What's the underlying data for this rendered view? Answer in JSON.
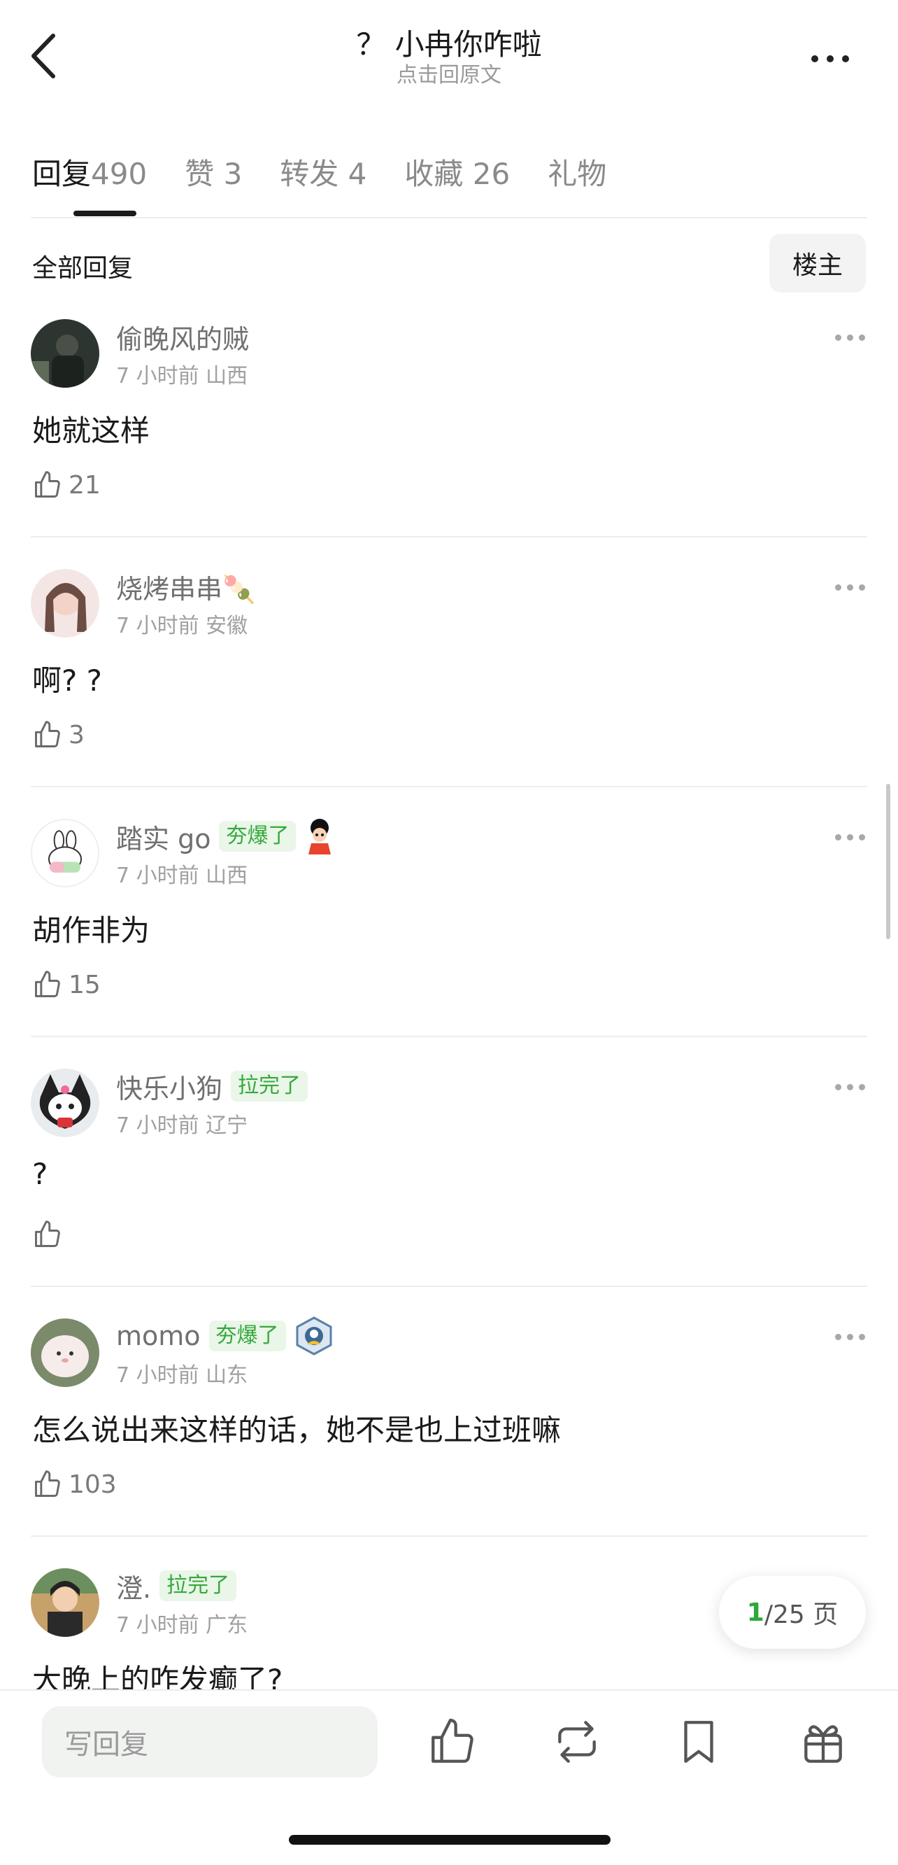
{
  "header": {
    "title": "？ 小冉你咋啦",
    "subtitle": "点击回原文"
  },
  "tabs": [
    {
      "label": "回复",
      "count": "490",
      "active": true
    },
    {
      "label": "赞",
      "count": "3"
    },
    {
      "label": "转发",
      "count": "4"
    },
    {
      "label": "收藏",
      "count": "26"
    },
    {
      "label": "礼物",
      "count": ""
    }
  ],
  "filter": {
    "all_label": "全部回复",
    "op_label": "楼主"
  },
  "comments": [
    {
      "username": "偷晚风的贼",
      "badge": "",
      "time": "7 小时前",
      "location": "山西",
      "text": "她就这样",
      "likes": "21"
    },
    {
      "username": "烧烤串串🍡",
      "badge": "",
      "time": "7 小时前",
      "location": "安徽",
      "text": "啊? ?",
      "likes": "3"
    },
    {
      "username": "踏实 go",
      "badge": "夯爆了",
      "time": "7 小时前",
      "location": "山西",
      "text": "胡作非为",
      "likes": "15"
    },
    {
      "username": "快乐小狗",
      "badge": "拉完了",
      "time": "7 小时前",
      "location": "辽宁",
      "text": "?",
      "likes": ""
    },
    {
      "username": "momo",
      "badge": "夯爆了",
      "time": "7 小时前",
      "location": "山东",
      "text": "怎么说出来这样的话，她不是也上过班嘛",
      "likes": "103"
    },
    {
      "username": "澄.",
      "badge": "拉完了",
      "time": "7 小时前",
      "location": "广东",
      "text": "大晚上的咋发癫了?",
      "likes": ""
    }
  ],
  "pagination": {
    "current": "1",
    "rest": "/25 页"
  },
  "bottom": {
    "reply_placeholder": "写回复"
  },
  "icons": {
    "back": "chevron-left-icon",
    "more": "more-horizontal-icon",
    "like": "thumbs-up-icon",
    "repost": "repost-icon",
    "bookmark": "bookmark-icon",
    "gift": "gift-icon"
  },
  "colors": {
    "accent_green": "#2ea83a",
    "badge_bg": "#e9f6e8",
    "badge_text": "#36a83c"
  }
}
